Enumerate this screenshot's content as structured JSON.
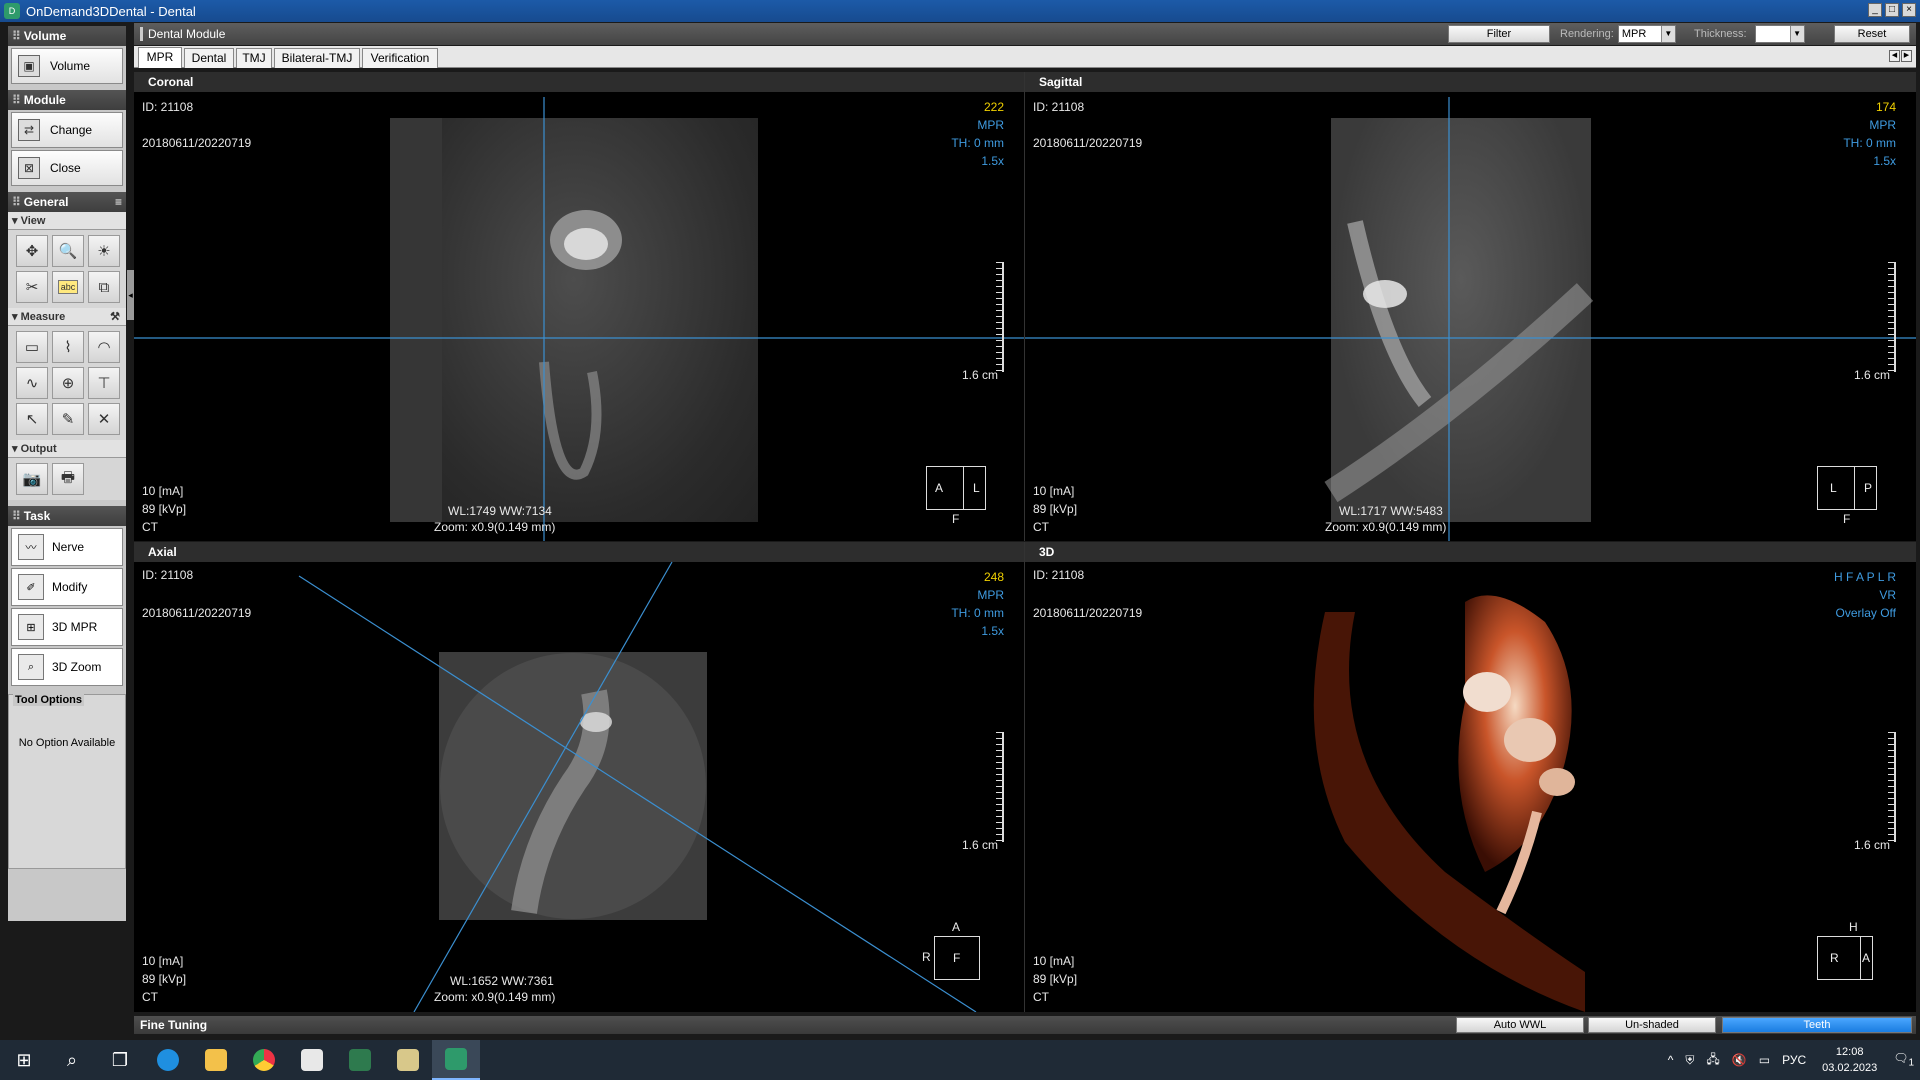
{
  "window": {
    "title": "OnDemand3DDental - Dental",
    "controls": [
      "_",
      "□",
      "×"
    ]
  },
  "left_panel": {
    "volume": {
      "header": "Volume",
      "button": "Volume"
    },
    "module": {
      "header": "Module",
      "change": "Change",
      "close": "Close"
    },
    "general": {
      "header": "General",
      "view": "View",
      "abc": "abc",
      "measure": "Measure",
      "output": "Output"
    },
    "task": {
      "header": "Task",
      "items": [
        "Nerve",
        "Modify",
        "3D MPR",
        "3D Zoom"
      ]
    },
    "tool_options": {
      "label": "Tool Options",
      "empty": "No Option Available"
    }
  },
  "module_bar": {
    "title": "Dental Module",
    "filter": "Filter",
    "rendering_label": "Rendering:",
    "rendering_value": "MPR",
    "thickness_label": "Thickness:",
    "thickness_value": "",
    "reset": "Reset"
  },
  "tabs": [
    "MPR",
    "Dental",
    "TMJ",
    "Bilateral-TMJ",
    "Verification"
  ],
  "active_tab": "MPR",
  "viewports": {
    "coronal": {
      "title": "Coronal",
      "id": "ID: 21108",
      "dates": "20180611/20220719",
      "slice": "222",
      "mode": "MPR",
      "th": "TH: 0 mm",
      "zoomx": "1.5x",
      "scale": "1.6 cm",
      "ma": "10 [mA]",
      "kvp": "89 [kVp]",
      "ct": "CT",
      "wl": "WL:1749  WW:7134",
      "zoom": "Zoom: x0.9(0.149 mm)",
      "orient_left": "A",
      "orient_right": "L",
      "orient_bottom": "F"
    },
    "sagittal": {
      "title": "Sagittal",
      "id": "ID: 21108",
      "dates": "20180611/20220719",
      "slice": "174",
      "mode": "MPR",
      "th": "TH: 0 mm",
      "zoomx": "1.5x",
      "scale": "1.6 cm",
      "ma": "10 [mA]",
      "kvp": "89 [kVp]",
      "ct": "CT",
      "wl": "WL:1717  WW:5483",
      "zoom": "Zoom: x0.9(0.149 mm)",
      "orient_left": "L",
      "orient_right": "P",
      "orient_bottom": "F"
    },
    "axial": {
      "title": "Axial",
      "id": "ID: 21108",
      "dates": "20180611/20220719",
      "slice": "248",
      "mode": "MPR",
      "th": "TH: 0 mm",
      "zoomx": "1.5x",
      "scale": "1.6 cm",
      "ma": "10 [mA]",
      "kvp": "89 [kVp]",
      "ct": "CT",
      "wl": "WL:1652  WW:7361",
      "zoom": "Zoom: x0.9(0.149 mm)",
      "orient_top": "A",
      "orient_left": "R",
      "orient_center": "F"
    },
    "vr3d": {
      "title": "3D",
      "id": "ID: 21108",
      "dates": "20180611/20220719",
      "dirs": "H F A P L R",
      "mode": "VR",
      "overlay": "Overlay Off",
      "scale": "1.6 cm",
      "ma": "10 [mA]",
      "kvp": "89 [kVp]",
      "ct": "CT",
      "orient_top": "H",
      "orient_left": "R",
      "orient_right": "A"
    }
  },
  "fine_tuning": {
    "label": "Fine Tuning",
    "auto_wwl": "Auto WWL",
    "unshaded": "Un-shaded",
    "teeth": "Teeth"
  },
  "taskbar": {
    "lang": "РУС",
    "time": "12:08",
    "date": "03.02.2023",
    "notif": "1"
  },
  "colors": {
    "crosshair": "#3b8fd0",
    "overlay_blue": "#3f9be0",
    "overlay_yellow": "#f0d000",
    "title_bar": "#1c5aa8"
  }
}
